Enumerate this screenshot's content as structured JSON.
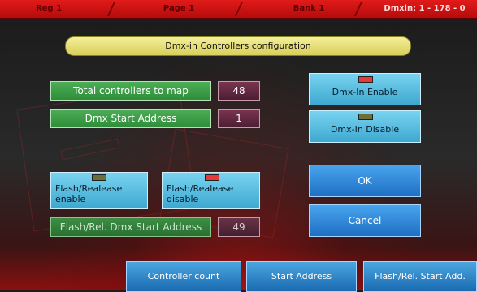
{
  "topbar": {
    "reg": "Reg 1",
    "page": "Page 1",
    "bank": "Bank 1",
    "dmxin": "Dmxin: 1 - 178 - 0"
  },
  "title": "Dmx-in Controllers configuration",
  "fields": {
    "total_controllers_label": "Total controllers to map",
    "total_controllers_value": "48",
    "dmx_start_label": "Dmx Start Address",
    "dmx_start_value": "1",
    "flash_dmx_start_label": "Flash/Rel. Dmx Start Address",
    "flash_dmx_start_value": "49"
  },
  "flash_buttons": {
    "enable_line1": "Flash/Realease",
    "enable_line2": "enable",
    "disable_line1": "Flash/Realease",
    "disable_line2": "disable"
  },
  "dmxin_buttons": {
    "enable_label": "Dmx-In Enable",
    "disable_label": "Dmx-In Disable"
  },
  "dialog": {
    "ok_label": "OK",
    "cancel_label": "Cancel"
  },
  "bottom_tabs": {
    "controller_count": "Controller count",
    "start_address": "Start Address",
    "flash_start": "Flash/Rel. Start Add."
  },
  "colors": {
    "topbar": "#d41414",
    "title_pill": "#e6df74",
    "green_label": "#3a9a45",
    "value_box": "#5e2840",
    "cyan_button": "#5bbfe2",
    "blue_button": "#2d86d8",
    "led_on": "#e83a3a",
    "led_off": "#6e6e3a"
  },
  "icons": {
    "enable_led": "red-led-icon",
    "disable_led": "off-led-icon"
  }
}
